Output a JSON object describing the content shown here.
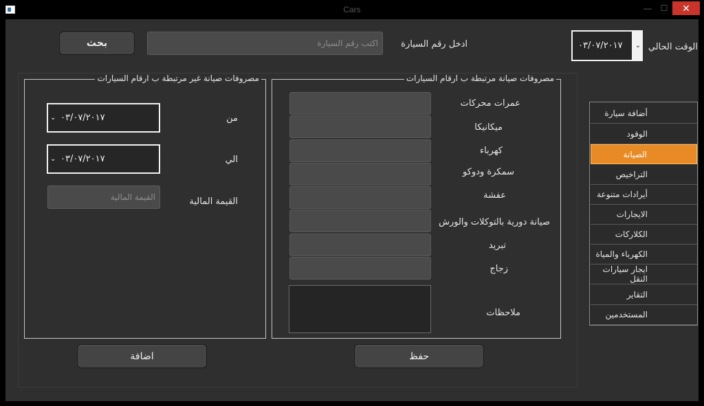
{
  "window": {
    "title": "Cars",
    "min_glyph": "—",
    "max_glyph": "☐",
    "close_glyph": "✕"
  },
  "top": {
    "current_time_label": "الوقت الحالي",
    "current_date": "٠٣/٠٧/٢٠١٧",
    "car_number_label": "ادخل رقم السيارة",
    "car_number_placeholder": "اكتب رقم السيارة",
    "car_number_value": "",
    "search_button": "بحث"
  },
  "linked_group": {
    "title": "مصروفات صيانة مرتبطة ب ارقام السيارات",
    "fields": [
      {
        "label": "عمرات محركات",
        "value": ""
      },
      {
        "label": "ميكانيكا",
        "value": ""
      },
      {
        "label": "كهرباء",
        "value": ""
      },
      {
        "label": "سمكرة ودوكو",
        "value": ""
      },
      {
        "label": "عفشة",
        "value": ""
      },
      {
        "label": "صيانة دورية بالتوكلات والورش",
        "value": ""
      },
      {
        "label": "تبريد",
        "value": ""
      },
      {
        "label": "زجاج",
        "value": ""
      }
    ],
    "notes_label": "ملاحظات",
    "notes_value": "",
    "save_button": "حفظ"
  },
  "unlinked_group": {
    "title": "مصروفات صيانة غير مرتبطة ب ارقام السيارات",
    "from_label": "من",
    "from_date": "٠٣/٠٧/٢٠١٧",
    "to_label": "الي",
    "to_date": "٠٣/٠٧/٢٠١٧",
    "amount_label": "القيمة المالية",
    "amount_placeholder": "القيمة المالية",
    "amount_value": "",
    "add_button": "اضافة"
  },
  "menu": {
    "active_index": 2,
    "items": [
      {
        "label": "أضافة سيارة"
      },
      {
        "label": "الوقود"
      },
      {
        "label": "الصيانة"
      },
      {
        "label": "التراخيص"
      },
      {
        "label": "أيرادات متنوعة"
      },
      {
        "label": "الايجارات"
      },
      {
        "label": "الكلاركات"
      },
      {
        "label": "الكهرباء والمياة"
      },
      {
        "label": "ايجار سيارات النقل"
      },
      {
        "label": "التقاير"
      },
      {
        "label": "المستخدمين"
      }
    ]
  },
  "icons": {
    "dropdown": "chevron-down-icon",
    "app": "app-window-icon"
  }
}
